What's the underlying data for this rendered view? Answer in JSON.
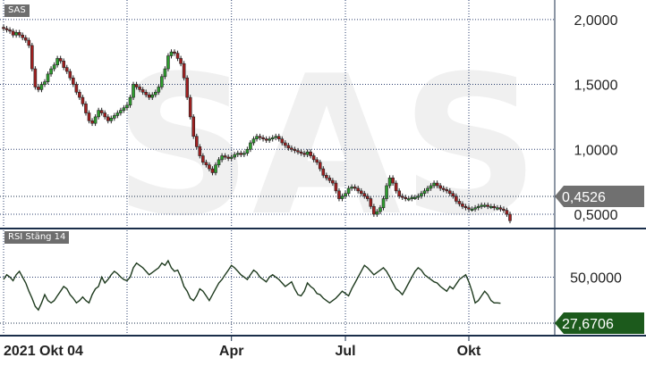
{
  "chart_data": [
    {
      "type": "candlestick",
      "title": "SAS",
      "ylim": [
        0.39,
        2.15
      ],
      "yticks": [
        "2,0000",
        "1,5000",
        "1,0000",
        "0,5000"
      ],
      "ytick_values": [
        2.0,
        1.5,
        1.0,
        0.5
      ],
      "last_value_label": "0,4526",
      "last_value": 0.4526,
      "colors": {
        "up": "#2e9e2e",
        "down": "#a02020",
        "grid": "#2b3f6e",
        "last_badge": "#707070"
      },
      "series": [
        {
          "close": [
            1.93,
            1.92,
            1.91,
            1.88,
            1.9,
            1.88,
            1.86,
            1.84,
            1.8,
            1.62,
            1.48,
            1.46,
            1.5,
            1.52,
            1.58,
            1.62,
            1.65,
            1.7,
            1.68,
            1.63,
            1.6,
            1.55,
            1.5,
            1.44,
            1.4,
            1.35,
            1.28,
            1.22,
            1.2,
            1.25,
            1.3,
            1.28,
            1.25,
            1.22,
            1.24,
            1.26,
            1.28,
            1.3,
            1.32,
            1.34,
            1.4,
            1.5,
            1.48,
            1.46,
            1.44,
            1.42,
            1.4,
            1.42,
            1.44,
            1.48,
            1.56,
            1.62,
            1.72,
            1.75,
            1.74,
            1.7,
            1.66,
            1.55,
            1.4,
            1.25,
            1.1,
            1.02,
            0.95,
            0.9,
            0.88,
            0.85,
            0.82,
            0.88,
            0.92,
            0.95,
            0.94,
            0.93,
            0.94,
            0.96,
            0.97,
            0.96,
            0.97,
            1.0,
            1.05,
            1.08,
            1.1,
            1.09,
            1.08,
            1.07,
            1.08,
            1.09,
            1.1,
            1.08,
            1.05,
            1.03,
            1.01,
            1.0,
            0.99,
            0.98,
            0.97,
            0.96,
            0.98,
            0.95,
            0.92,
            0.9,
            0.85,
            0.8,
            0.78,
            0.76,
            0.74,
            0.68,
            0.62,
            0.64,
            0.66,
            0.7,
            0.71,
            0.7,
            0.68,
            0.66,
            0.64,
            0.62,
            0.56,
            0.5,
            0.52,
            0.55,
            0.62,
            0.72,
            0.78,
            0.74,
            0.68,
            0.64,
            0.63,
            0.62,
            0.62,
            0.63,
            0.63,
            0.64,
            0.66,
            0.68,
            0.7,
            0.72,
            0.74,
            0.72,
            0.7,
            0.69,
            0.68,
            0.66,
            0.64,
            0.6,
            0.58,
            0.56,
            0.55,
            0.54,
            0.54,
            0.55,
            0.56,
            0.57,
            0.57,
            0.56,
            0.56,
            0.55,
            0.55,
            0.54,
            0.53,
            0.5,
            0.45
          ]
        }
      ]
    },
    {
      "type": "line",
      "title": "RSI Stäng 14",
      "ylim": [
        0,
        100
      ],
      "yticks": [
        "50,0000"
      ],
      "ytick_values": [
        50
      ],
      "last_value_label": "27,6706",
      "last_value": 27.67,
      "xticks": [
        "2021 Okt 04",
        "Apr",
        "Jul",
        "Okt"
      ],
      "xtick_positions": [
        0,
        72,
        108,
        147
      ],
      "colors": {
        "line": "#1e3a1e",
        "last_badge": "#1c5a1c"
      },
      "series": [
        {
          "values": [
            48,
            52,
            50,
            47,
            52,
            55,
            50,
            45,
            38,
            32,
            25,
            22,
            28,
            35,
            30,
            28,
            30,
            34,
            38,
            42,
            40,
            35,
            32,
            28,
            30,
            33,
            30,
            28,
            35,
            40,
            42,
            50,
            45,
            48,
            52,
            55,
            53,
            50,
            48,
            47,
            50,
            58,
            62,
            60,
            58,
            55,
            52,
            54,
            56,
            58,
            62,
            60,
            64,
            58,
            55,
            56,
            50,
            42,
            38,
            32,
            30,
            34,
            40,
            38,
            34,
            30,
            35,
            40,
            45,
            48,
            52,
            56,
            60,
            58,
            55,
            52,
            50,
            48,
            52,
            56,
            54,
            50,
            48,
            46,
            50,
            52,
            50,
            48,
            45,
            42,
            44,
            46,
            40,
            35,
            34,
            38,
            45,
            42,
            40,
            36,
            35,
            32,
            30,
            28,
            30,
            32,
            35,
            38,
            36,
            34,
            40,
            45,
            50,
            55,
            60,
            58,
            55,
            52,
            54,
            56,
            58,
            55,
            50,
            45,
            40,
            38,
            35,
            40,
            45,
            50,
            55,
            58,
            56,
            52,
            50,
            48,
            46,
            45,
            42,
            40,
            38,
            42,
            40,
            44,
            48,
            50,
            52,
            46,
            38,
            28,
            30,
            34,
            38,
            35,
            30,
            28,
            28,
            27.67
          ]
        }
      ]
    }
  ]
}
